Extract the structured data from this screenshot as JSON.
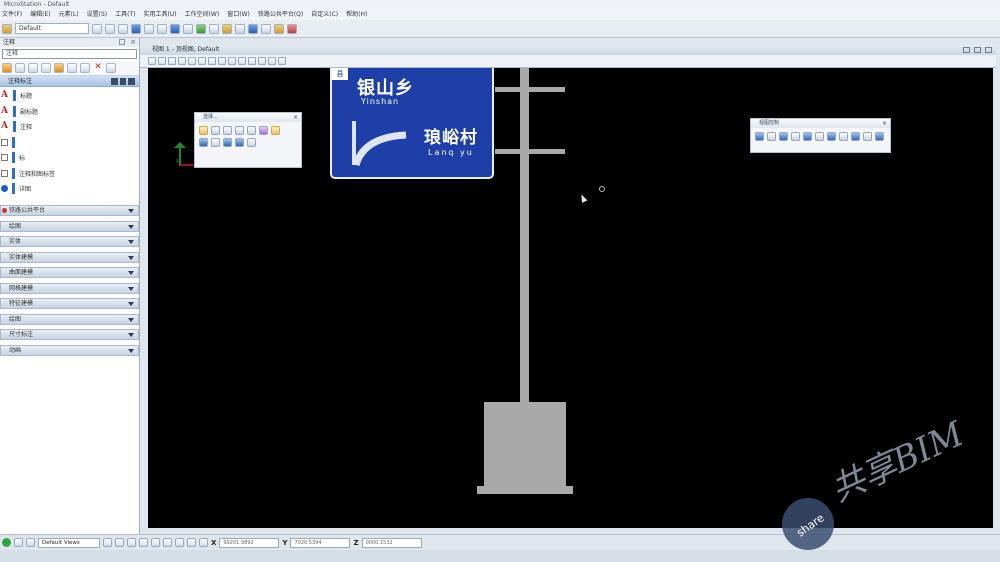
{
  "window": {
    "title": "MicroStation - Default"
  },
  "menu": {
    "items": [
      "文件(F)",
      "编辑(E)",
      "元素(L)",
      "设置(S)",
      "工具(T)",
      "实用工具(U)",
      "工作空间(W)",
      "窗口(W)",
      "铁路公共平台(Q)",
      "自定义(C)",
      "帮助(H)"
    ]
  },
  "toolbar": {
    "level_combo": "Default",
    "view_combo": "Default"
  },
  "panel": {
    "title": "注释",
    "search_placeholder": "注释",
    "section_title": "注释标注",
    "items": [
      {
        "label": "标题",
        "icon": "text-a-icon"
      },
      {
        "label": "副标题",
        "icon": "text-a-icon"
      },
      {
        "label": "注释",
        "icon": "text-a-icon"
      },
      {
        "label": "",
        "icon": "box-icon"
      },
      {
        "label": "标",
        "icon": "box-icon"
      },
      {
        "label": "注释和图标签",
        "icon": "box-icon"
      },
      {
        "label": "详图",
        "icon": "blue-dot-icon"
      }
    ],
    "groups": [
      "铁路公共平台",
      "绘图",
      "实体",
      "实体建模",
      "曲面建模",
      "网格建模",
      "特征建模",
      "绘图",
      "尺寸标注",
      "动画"
    ]
  },
  "view": {
    "title": "视图 1 - 顶视图, Default"
  },
  "sign": {
    "badge": "县",
    "line1_cn": "银山乡",
    "line1_en": "Yinshan",
    "line2_cn": "琅峪村",
    "line2_en": "Lanq yu",
    "bg_color": "#1e3fa8"
  },
  "floating": {
    "left_title": "选择...",
    "right_title": "视图控制"
  },
  "status": {
    "view_combo": "Default Views",
    "x_label": "X",
    "x_value": "99201.9892",
    "y_label": "Y",
    "y_value": "7020.5394",
    "z_label": "Z",
    "z_value": "0000.1532"
  },
  "watermark": {
    "text": "共享BIM",
    "badge": "share"
  }
}
